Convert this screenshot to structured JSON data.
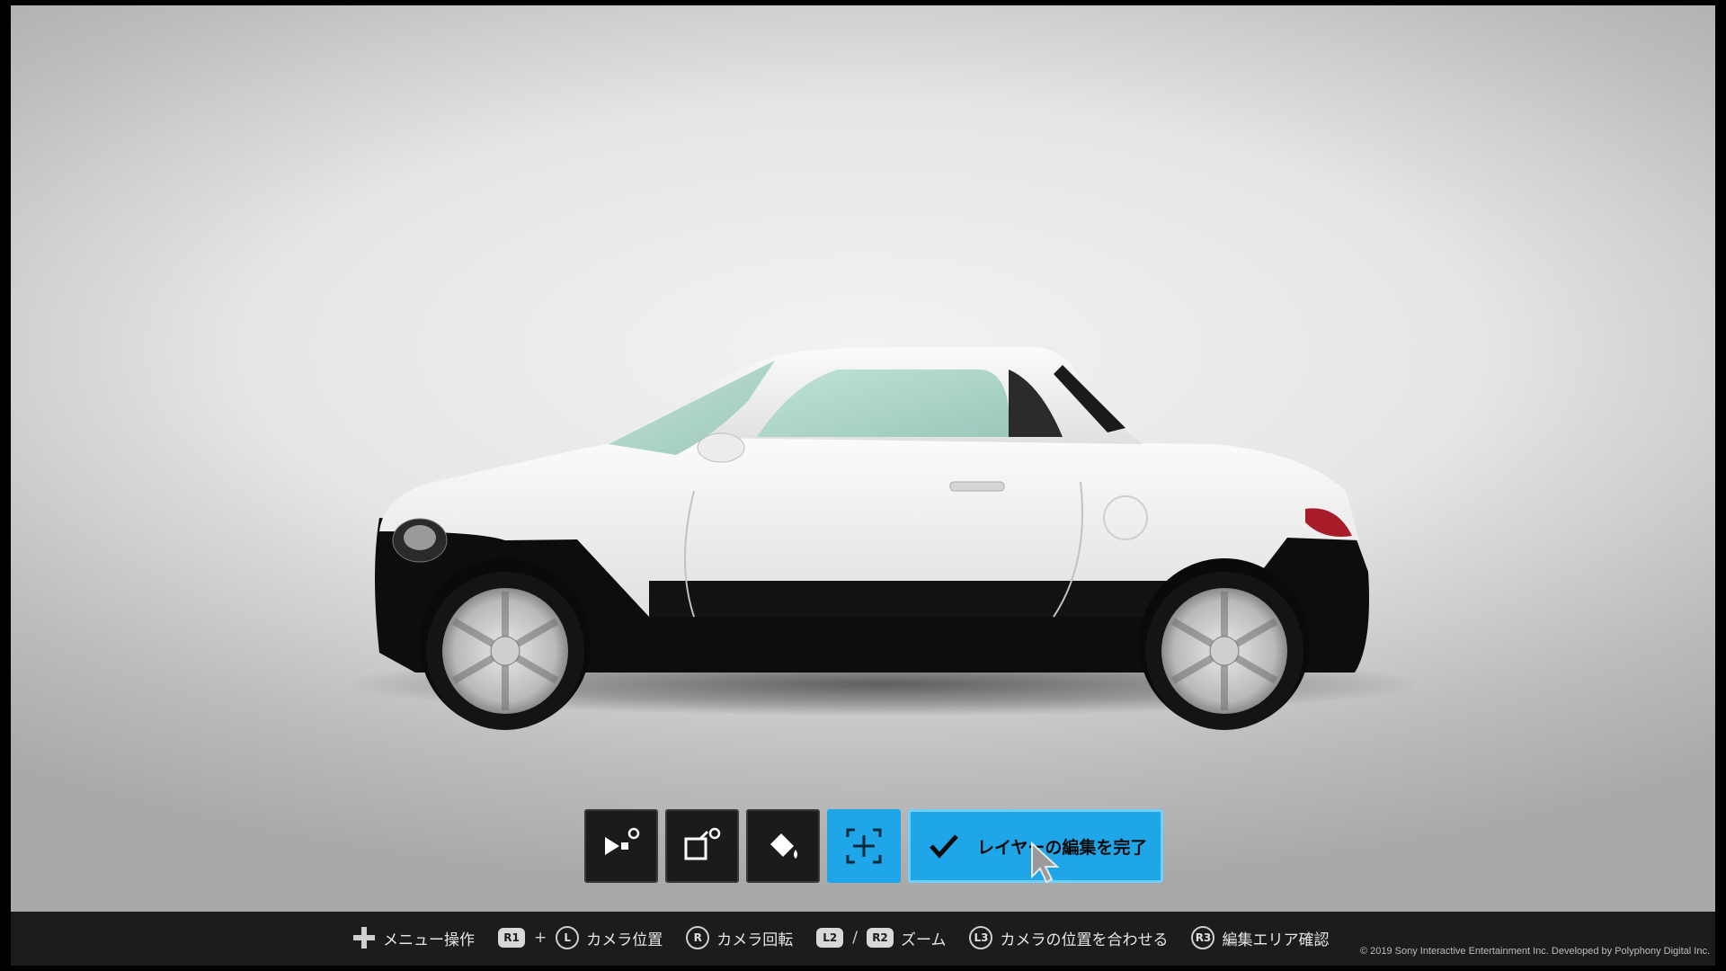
{
  "toolbar": {
    "buttons": [
      {
        "icon": "play-settings-icon",
        "active": false
      },
      {
        "icon": "layer-settings-icon",
        "active": false
      },
      {
        "icon": "paint-bucket-icon",
        "active": false
      },
      {
        "icon": "move-crosshair-icon",
        "active": true
      }
    ],
    "finish_label": "レイヤーの編集を完了",
    "finish_icon": "checkmark-icon",
    "accent_color": "#1ea6e8"
  },
  "hints": {
    "menu": {
      "label": "メニュー操作"
    },
    "camera_position": {
      "btn": "R1",
      "plus": "+",
      "stick": "L",
      "label": "カメラ位置"
    },
    "camera_rotate": {
      "stick": "R",
      "label": "カメラ回転"
    },
    "zoom": {
      "btn1": "L2",
      "sep": "/",
      "btn2": "R2",
      "label": "ズーム"
    },
    "camera_align": {
      "stick": "L3",
      "label": "カメラの位置を合わせる"
    },
    "edit_area": {
      "stick": "R3",
      "label": "編集エリア確認"
    }
  },
  "copyright": "© 2019 Sony Interactive Entertainment Inc. Developed by Polyphony Digital Inc."
}
